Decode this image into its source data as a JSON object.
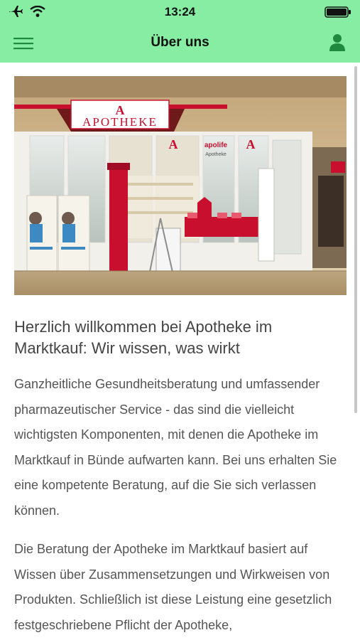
{
  "status": {
    "time": "13:24",
    "icons": [
      "airplane-icon",
      "wifi-icon",
      "battery-icon"
    ]
  },
  "nav": {
    "title": "Über uns",
    "menu_icon": "hamburger-icon",
    "user_icon": "user-icon"
  },
  "hero": {
    "sign_text": "APOTHEKE",
    "store_label": "apolife",
    "store_sublabel": "Apotheke"
  },
  "content": {
    "heading": "Herzlich willkommen bei Apotheke im Marktkauf: Wir wissen, was wirkt",
    "paragraph1": "Ganzheitliche Gesundheitsberatung und umfassender pharmazeutischer Service - das sind die vielleicht wichtigsten Komponenten, mit denen die Apotheke im Marktkauf in Bünde aufwarten kann. Bei uns erhalten Sie eine kompetente Beratung, auf die Sie sich verlassen können.",
    "paragraph2": "Die Beratung der Apotheke im Marktkauf basiert auf Wissen über Zusammensetzungen und Wirkweisen von Produkten. Schließlich ist diese Leistung eine gesetzlich festgeschriebene Pflicht der Apotheke,"
  },
  "colors": {
    "header_bg": "#86eda2",
    "accent_icon": "#1f8a3d",
    "pharmacy_red": "#c8102e"
  }
}
